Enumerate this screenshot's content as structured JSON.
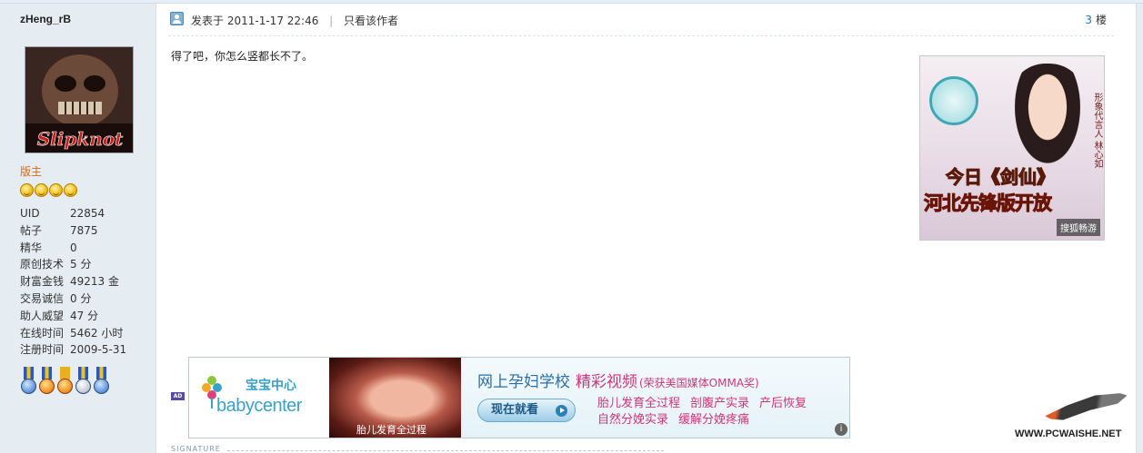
{
  "author": {
    "name": "zHeng_rB",
    "avatar_text": "Slipknot",
    "role": "版主",
    "stars": 4,
    "stats": [
      {
        "label": "UID",
        "value": "22854"
      },
      {
        "label": "帖子",
        "value": "7875"
      },
      {
        "label": "精华",
        "value": "0"
      },
      {
        "label": "原创技术",
        "value": "5 分"
      },
      {
        "label": "财富金钱",
        "value": "49213 金"
      },
      {
        "label": "交易诚信",
        "value": "0 分"
      },
      {
        "label": "助人威望",
        "value": "47 分"
      },
      {
        "label": "在线时间",
        "value": "5462 小时"
      },
      {
        "label": "注册时间",
        "value": "2009-5-31"
      }
    ],
    "medals": [
      "medal-icon",
      "medal-icon",
      "medal-icon",
      "medal-icon",
      "medal-icon"
    ]
  },
  "post": {
    "posted_label": "发表于",
    "posted_time": "2011-1-17 22:46",
    "separator": "|",
    "only_author": "只看该作者",
    "floor_number": "3",
    "floor_label": "楼",
    "content": "得了吧，你怎么竖都长不了。"
  },
  "side_ad": {
    "vertical_text": "形象代言人 林心如",
    "headline1": "今日《剑仙》",
    "headline2": "河北先锋版开放",
    "brand": "搜狐畅游"
  },
  "banner_ad": {
    "ad_tag": "AD",
    "logo_cn": "宝宝中心",
    "logo_en": "babycenter",
    "photo_caption": "胎儿发育全过程",
    "title": "网上孕妇学校",
    "title_highlight": "精彩视频",
    "title_sub": "(荣获美国媒体OMMA奖)",
    "cta": "现在就看",
    "links_row1": [
      "胎儿发育全过程",
      "剖腹产实录",
      "产后恢复"
    ],
    "links_row2": [
      "自然分娩实录",
      "缓解分娩疼痛"
    ],
    "info": "i"
  },
  "signature_label": "SIGNATURE",
  "watermark_url": "WWW.PCWAISHE.NET"
}
